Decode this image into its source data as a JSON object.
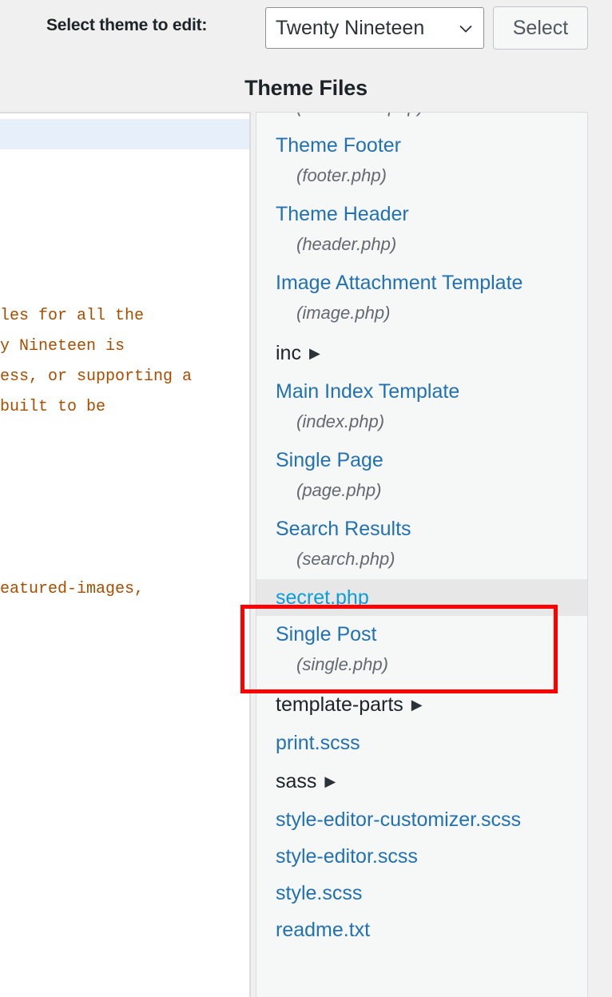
{
  "colors": {
    "page_bg": "#f0f0f1",
    "panel_bg": "#f6f7f7",
    "link": "#2271b1",
    "link_hover": "#0c9cd6",
    "highlight_row": "#e7e7e7",
    "annotation": "#ff0000",
    "code_comment": "#a64d00",
    "active_line": "#e6effa"
  },
  "toolbar": {
    "label": "Select theme to edit:",
    "theme_select_value": "Twenty Nineteen",
    "chevron_icon": "chevron-down-icon",
    "select_button_label": "Select"
  },
  "heading": {
    "theme_files": "Theme Files"
  },
  "code_editor": {
    "lines": [
      "",
      "",
      "",
      "",
      "",
      "",
      "les for all the",
      "y Nineteen is",
      "ess, or supporting a",
      "built to be",
      "",
      "",
      "",
      "",
      "",
      "eatured-images,"
    ]
  },
  "file_list": [
    {
      "type": "slug_only",
      "slug": "(comments.php)"
    },
    {
      "type": "file",
      "label": "Theme Footer",
      "slug": "(footer.php)"
    },
    {
      "type": "file",
      "label": "Theme Header",
      "slug": "(header.php)"
    },
    {
      "type": "file",
      "label": "Image Attachment Template",
      "slug": "(image.php)"
    },
    {
      "type": "folder",
      "label": "inc",
      "caret": "▶"
    },
    {
      "type": "file",
      "label": "Main Index Template",
      "slug": "(index.php)"
    },
    {
      "type": "file",
      "label": "Single Page",
      "slug": "(page.php)"
    },
    {
      "type": "file",
      "label": "Search Results",
      "slug": "(search.php)"
    },
    {
      "type": "file",
      "label": "secret.php",
      "slug": "",
      "highlighted": true
    },
    {
      "type": "file",
      "label": "Single Post",
      "slug": "(single.php)"
    },
    {
      "type": "folder",
      "label": "template-parts",
      "caret": "▶"
    },
    {
      "type": "file",
      "label": "print.scss",
      "slug": ""
    },
    {
      "type": "folder",
      "label": "sass",
      "caret": "▶"
    },
    {
      "type": "file",
      "label": "style-editor-customizer.scss",
      "slug": ""
    },
    {
      "type": "file",
      "label": "style-editor.scss",
      "slug": ""
    },
    {
      "type": "file",
      "label": "style.scss",
      "slug": ""
    },
    {
      "type": "file",
      "label": "readme.txt",
      "slug": ""
    }
  ],
  "annotation": {
    "name": "red-highlight-box",
    "covers": [
      "secret.php",
      "Single Post"
    ]
  }
}
